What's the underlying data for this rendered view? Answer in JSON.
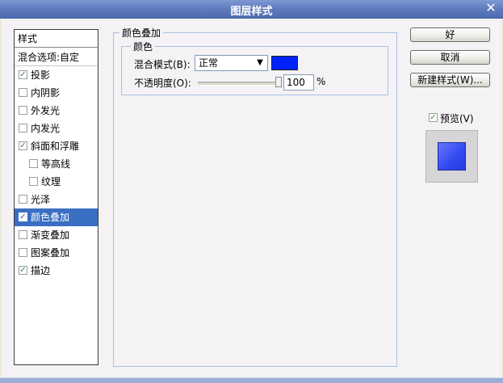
{
  "window": {
    "title": "图层样式",
    "close_glyph": "✕"
  },
  "styles_panel": {
    "header": "样式",
    "blend_options": "混合选项:自定",
    "items": [
      {
        "label": "投影",
        "checked": true,
        "indent": false,
        "selected": false
      },
      {
        "label": "内阴影",
        "checked": false,
        "indent": false,
        "selected": false
      },
      {
        "label": "外发光",
        "checked": false,
        "indent": false,
        "selected": false
      },
      {
        "label": "内发光",
        "checked": false,
        "indent": false,
        "selected": false
      },
      {
        "label": "斜面和浮雕",
        "checked": true,
        "indent": false,
        "selected": false
      },
      {
        "label": "等高线",
        "checked": false,
        "indent": true,
        "selected": false
      },
      {
        "label": "纹理",
        "checked": false,
        "indent": true,
        "selected": false
      },
      {
        "label": "光泽",
        "checked": false,
        "indent": false,
        "selected": false
      },
      {
        "label": "颜色叠加",
        "checked": true,
        "indent": false,
        "selected": true
      },
      {
        "label": "渐变叠加",
        "checked": false,
        "indent": false,
        "selected": false
      },
      {
        "label": "图案叠加",
        "checked": false,
        "indent": false,
        "selected": false
      },
      {
        "label": "描边",
        "checked": true,
        "indent": false,
        "selected": false
      }
    ]
  },
  "color_overlay": {
    "group_title": "颜色叠加",
    "sub_title": "颜色",
    "blend_mode_label": "混合模式(B):",
    "blend_mode_value": "正常",
    "overlay_color": "#0022FF",
    "opacity_label": "不透明度(O):",
    "opacity_value": "100",
    "opacity_unit": "%"
  },
  "buttons": {
    "ok": "好",
    "cancel": "取消",
    "new_style": "新建样式(W)..."
  },
  "preview": {
    "label": "预览(V)",
    "checked": true
  },
  "colors": {
    "selection": "#3A6EC2",
    "checkmark": "#2F8A2F",
    "preview_fill": "#3048F0"
  }
}
